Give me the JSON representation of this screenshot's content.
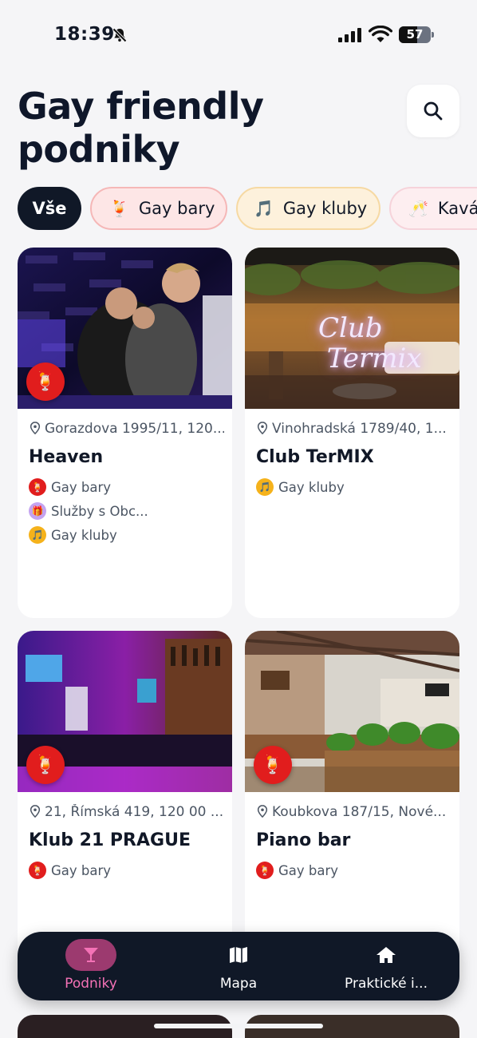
{
  "status_bar": {
    "time": "18:39",
    "battery": "57",
    "battery_level": 0.57
  },
  "header": {
    "title": "Gay friendly podniky"
  },
  "filters": [
    {
      "label": "Vše",
      "icon": "all",
      "selected": true
    },
    {
      "label": "Gay bary",
      "icon": "🍹",
      "selected": false
    },
    {
      "label": "Gay kluby",
      "icon": "🎵",
      "selected": false
    },
    {
      "label": "Kavárny",
      "icon": "🥂",
      "selected": false
    }
  ],
  "venues": [
    {
      "address": "Gorazdova 1995/11, 120...",
      "name": "Heaven",
      "badge_icon": "cocktail-icon",
      "tags": [
        {
          "label": "Gay bary",
          "icon": "🍹"
        },
        {
          "label": "Služby s Obc...",
          "icon": "🎁"
        },
        {
          "label": "Gay kluby",
          "icon": "🎵"
        }
      ]
    },
    {
      "address": "Vinohradská 1789/40, 1...",
      "name": "Club TerMIX",
      "image_text": "Club Termix",
      "tags": [
        {
          "label": "Gay kluby",
          "icon": "🎵"
        }
      ]
    },
    {
      "address": "21, Římská 419, 120 00 ...",
      "name": "Klub 21 PRAGUE",
      "badge_icon": "cocktail-icon",
      "tags": [
        {
          "label": "Gay bary",
          "icon": "🍹"
        }
      ]
    },
    {
      "address": "Koubkova 187/15, Nové...",
      "name": "Piano bar",
      "badge_icon": "cocktail-icon",
      "tags": [
        {
          "label": "Gay bary",
          "icon": "🍹"
        }
      ]
    }
  ],
  "bottom_nav": [
    {
      "label": "Podniky",
      "icon": "cocktail-glass-icon",
      "active": true
    },
    {
      "label": "Mapa",
      "icon": "map-icon",
      "active": false
    },
    {
      "label": "Praktické i...",
      "icon": "home-icon",
      "active": false
    }
  ],
  "colors": {
    "primary_dark": "#101827",
    "accent_pink": "#f472b6",
    "badge_red": "#e11d1d",
    "background": "#f5f5f7"
  }
}
